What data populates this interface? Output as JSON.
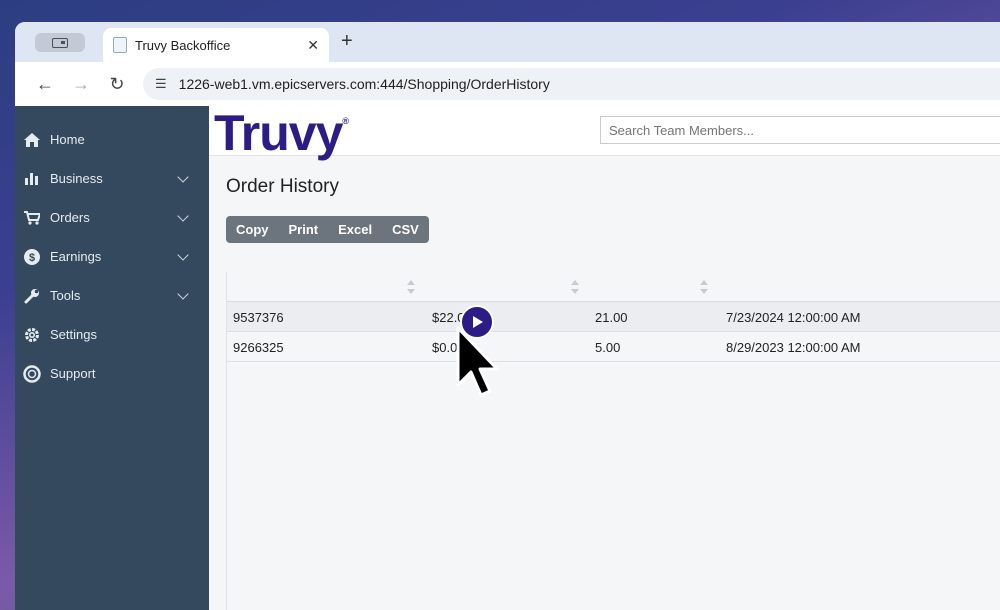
{
  "browser": {
    "tab_title": "Truvy Backoffice",
    "tab_close": "✕",
    "new_tab": "+",
    "url": "1226-web1.vm.epicservers.com:444/Shopping/OrderHistory"
  },
  "sidebar": {
    "items": [
      {
        "label": "Home",
        "icon": "home-icon"
      },
      {
        "label": "Business",
        "icon": "bar-chart-icon"
      },
      {
        "label": "Orders",
        "icon": "cart-icon"
      },
      {
        "label": "Earnings",
        "icon": "dollar-icon"
      },
      {
        "label": "Tools",
        "icon": "wrench-icon"
      },
      {
        "label": "Settings",
        "icon": "gear-icon"
      },
      {
        "label": "Support",
        "icon": "lifebuoy-icon"
      }
    ]
  },
  "header": {
    "logo": "Truvy",
    "logo_mark": "®",
    "search_placeholder": "Search Team Members..."
  },
  "page": {
    "title": "Order History",
    "export_buttons": [
      "Copy",
      "Print",
      "Excel",
      "CSV"
    ]
  },
  "table": {
    "rows": [
      [
        "9537376",
        "$22.00",
        "21.00",
        "7/23/2024 12:00:00 AM"
      ],
      [
        "9266325",
        "$0.0",
        "5.00",
        "8/29/2023 12:00:00 AM"
      ]
    ]
  },
  "colors": {
    "sidebar": "#34495e",
    "brand": "#2d1c86",
    "button_group": "#6c757d"
  }
}
